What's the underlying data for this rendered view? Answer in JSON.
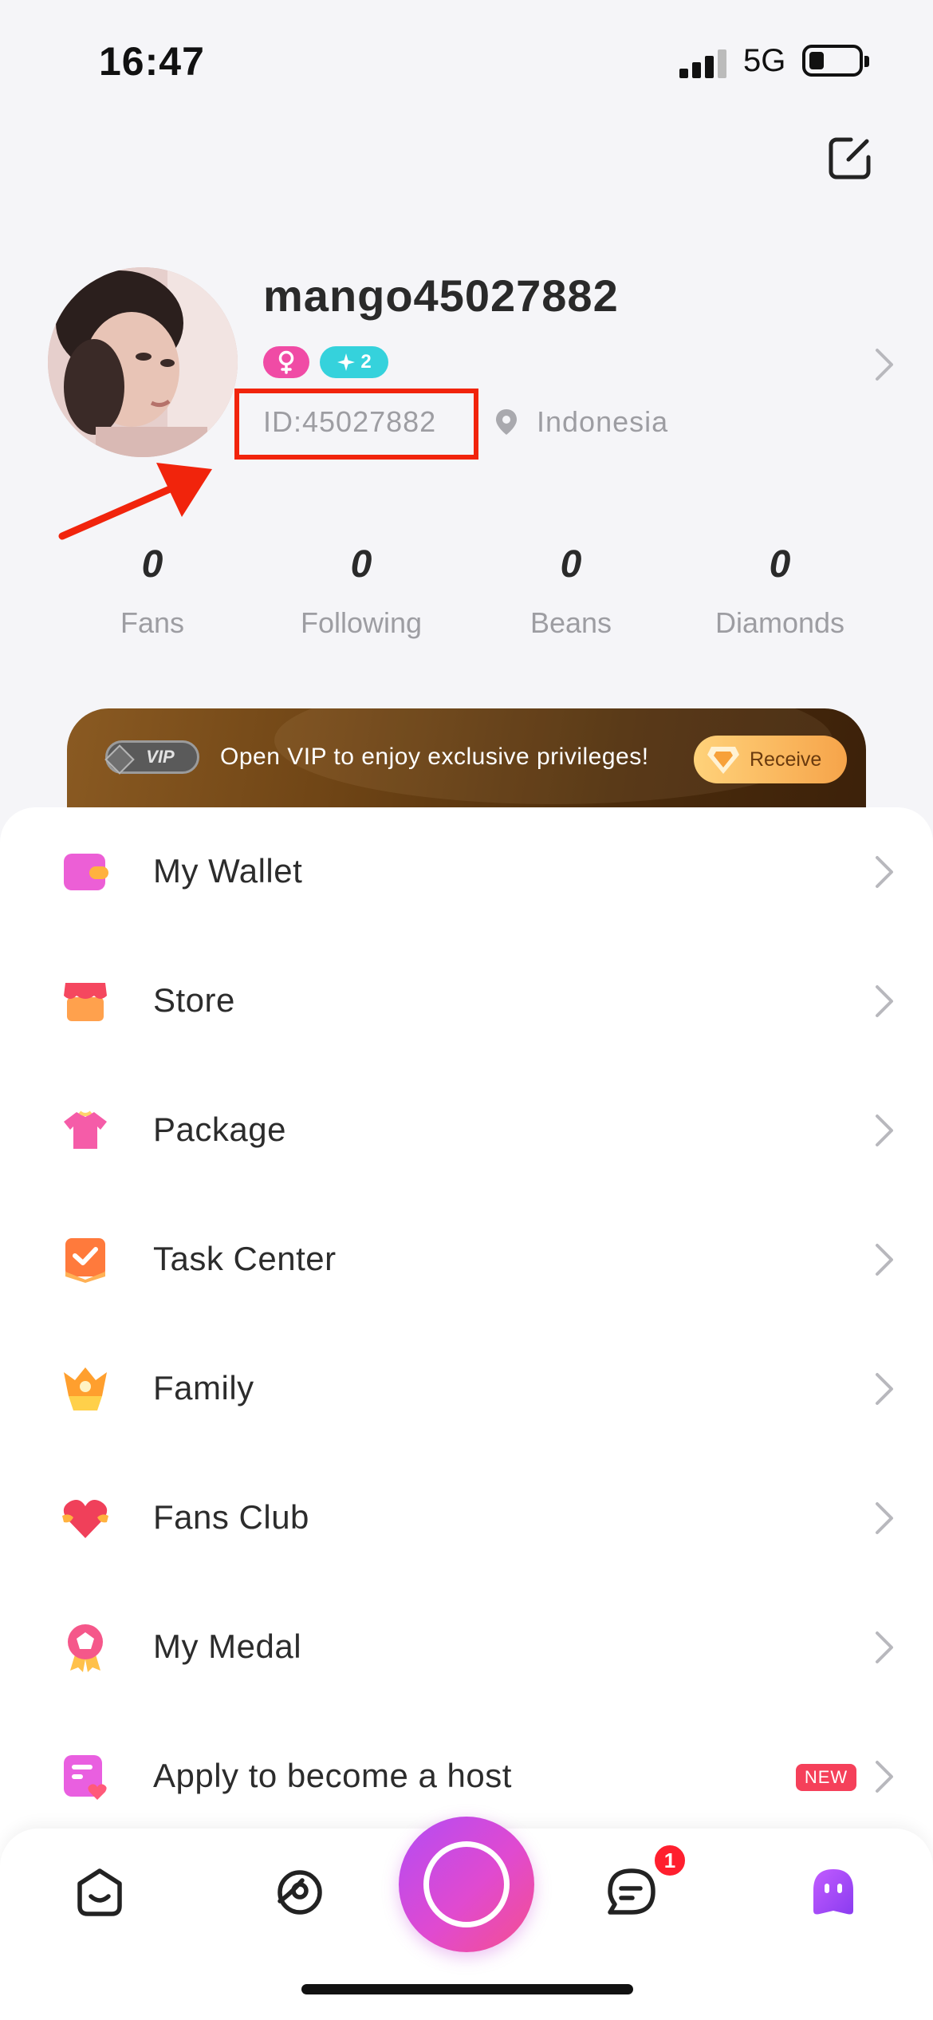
{
  "status_bar": {
    "time": "16:47",
    "network": "5G"
  },
  "profile": {
    "username": "mango45027882",
    "level": "2",
    "user_id": "ID:45027882",
    "location": "Indonesia"
  },
  "stats": [
    {
      "value": "0",
      "label": "Fans"
    },
    {
      "value": "0",
      "label": "Following"
    },
    {
      "value": "0",
      "label": "Beans"
    },
    {
      "value": "0",
      "label": "Diamonds"
    }
  ],
  "vip_banner": {
    "tag": "VIP",
    "text": "Open VIP to enjoy exclusive privileges!",
    "button": "Receive"
  },
  "menu": [
    {
      "label": "My Wallet",
      "icon": "wallet-icon"
    },
    {
      "label": "Store",
      "icon": "store-icon"
    },
    {
      "label": "Package",
      "icon": "package-icon"
    },
    {
      "label": "Task Center",
      "icon": "task-center-icon"
    },
    {
      "label": "Family",
      "icon": "family-icon"
    },
    {
      "label": "Fans Club",
      "icon": "fans-club-icon"
    },
    {
      "label": "My Medal",
      "icon": "medal-icon"
    },
    {
      "label": "Apply to become a host",
      "icon": "host-apply-icon",
      "badge": "NEW"
    }
  ],
  "bottom_nav": {
    "items": [
      "home-icon",
      "explore-icon",
      "live-icon",
      "messages-icon",
      "profile-icon"
    ],
    "message_count": "1"
  },
  "colors": {
    "annotation": "#f1240c",
    "accent_pink": "#f04ba5",
    "accent_cyan": "#35d2dc",
    "new_badge": "#f5405a"
  }
}
